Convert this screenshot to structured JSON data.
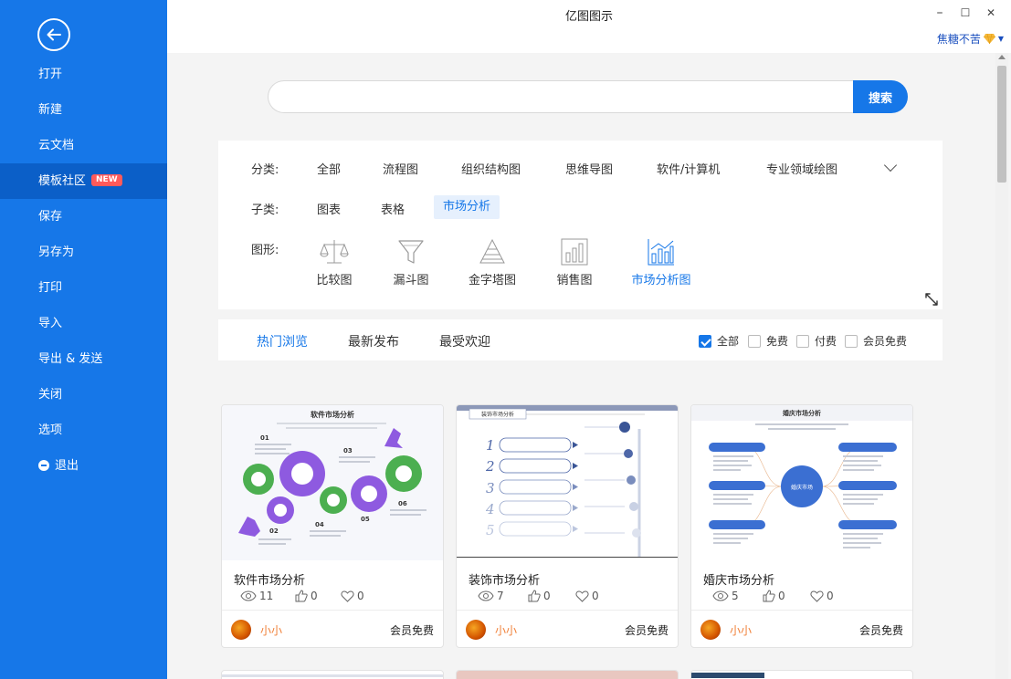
{
  "app": {
    "title": "亿图图示"
  },
  "window": {
    "minimize": "–",
    "maximize": "☐",
    "close": "✕"
  },
  "user": {
    "name": "焦糖不苦"
  },
  "sidebar": {
    "items": [
      {
        "label": "打开"
      },
      {
        "label": "新建"
      },
      {
        "label": "云文档"
      },
      {
        "label": "模板社区",
        "badge": "NEW",
        "active": true
      },
      {
        "label": "保存"
      },
      {
        "label": "另存为"
      },
      {
        "label": "打印"
      },
      {
        "label": "导入"
      },
      {
        "label": "导出 & 发送"
      },
      {
        "label": "关闭"
      },
      {
        "label": "选项"
      },
      {
        "label": "退出"
      }
    ]
  },
  "search": {
    "placeholder": "",
    "button_label": "搜索"
  },
  "filters": {
    "category_label": "分类:",
    "categories": [
      "全部",
      "流程图",
      "组织结构图",
      "思维导图",
      "软件/计算机",
      "专业领域绘图"
    ],
    "subcategory_label": "子类:",
    "subcategories": [
      "图表",
      "表格",
      "市场分析"
    ],
    "subcategory_selected": "市场分析",
    "shape_label": "图形:",
    "shapes": [
      "比较图",
      "漏斗图",
      "金字塔图",
      "销售图",
      "市场分析图"
    ],
    "shape_selected": "市场分析图"
  },
  "sort": {
    "tabs": [
      "热门浏览",
      "最新发布",
      "最受欢迎"
    ],
    "active": "热门浏览",
    "price_filters": [
      {
        "label": "全部",
        "checked": true
      },
      {
        "label": "免费",
        "checked": false
      },
      {
        "label": "付费",
        "checked": false
      },
      {
        "label": "会员免费",
        "checked": false
      }
    ]
  },
  "cards": [
    {
      "title": "软件市场分析",
      "views": "11",
      "likes": "0",
      "favorites": "0",
      "author": "小小",
      "price": "会员免费",
      "thumb": {
        "heading": "软件市场分析",
        "numbers": [
          "01",
          "02",
          "03",
          "04",
          "05",
          "06"
        ]
      }
    },
    {
      "title": "装饰市场分析",
      "views": "7",
      "likes": "0",
      "favorites": "0",
      "author": "小小",
      "price": "会员免费",
      "thumb": {
        "heading": "装饰市场分析",
        "numbers": [
          "1",
          "2",
          "3",
          "4",
          "5"
        ]
      }
    },
    {
      "title": "婚庆市场分析",
      "views": "5",
      "likes": "0",
      "favorites": "0",
      "author": "小小",
      "price": "会员免费",
      "thumb": {
        "heading": "婚庆市场分析",
        "center": "婚庆市场"
      }
    }
  ],
  "colors": {
    "accent": "#1677e8",
    "sidebar_active": "#0b5fc8",
    "author": "#f07f36",
    "badge": "#ff5a5a"
  }
}
